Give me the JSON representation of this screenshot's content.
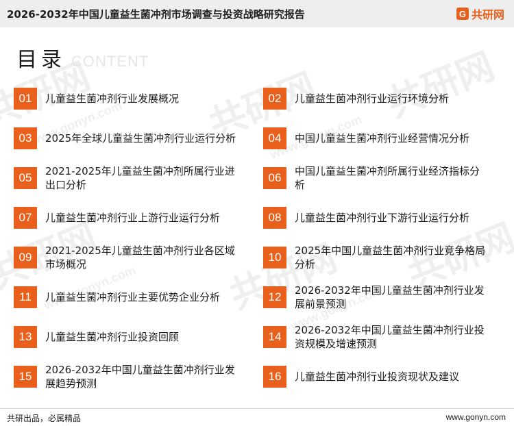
{
  "header": {
    "report_title": "2026-2032年中国儿童益生菌冲剂市场调查与投资战略研究报告",
    "brand_mark": "G",
    "brand_name": "共研网"
  },
  "toc": {
    "title": "目录",
    "subtitle": "CONTENT",
    "items": [
      {
        "num": "01",
        "label": "儿童益生菌冲剂行业发展概况"
      },
      {
        "num": "02",
        "label": "儿童益生菌冲剂行业运行环境分析"
      },
      {
        "num": "03",
        "label": "2025年全球儿童益生菌冲剂行业运行分析"
      },
      {
        "num": "04",
        "label": "中国儿童益生菌冲剂行业经营情况分析"
      },
      {
        "num": "05",
        "label": "2021-2025年儿童益生菌冲剂所属行业进出口分析"
      },
      {
        "num": "06",
        "label": "中国儿童益生菌冲剂所属行业经济指标分析"
      },
      {
        "num": "07",
        "label": "儿童益生菌冲剂行业上游行业运行分析"
      },
      {
        "num": "08",
        "label": "儿童益生菌冲剂行业下游行业运行分析"
      },
      {
        "num": "09",
        "label": "2021-2025年儿童益生菌冲剂行业各区域市场概况"
      },
      {
        "num": "10",
        "label": "2025年中国儿童益生菌冲剂行业竞争格局分析"
      },
      {
        "num": "11",
        "label": "儿童益生菌冲剂行业主要优势企业分析"
      },
      {
        "num": "12",
        "label": "2026-2032年中国儿童益生菌冲剂行业发展前景预测"
      },
      {
        "num": "13",
        "label": "儿童益生菌冲剂行业投资回顾"
      },
      {
        "num": "14",
        "label": "2026-2032年中国儿童益生菌冲剂行业投资规模及增速预测"
      },
      {
        "num": "15",
        "label": "2026-2032年中国儿童益生菌冲剂行业发展趋势预测"
      },
      {
        "num": "16",
        "label": "儿童益生菌冲剂行业投资现状及建议"
      }
    ]
  },
  "watermark": {
    "brand": "共研网",
    "domain": "www.gonyn.com"
  },
  "footer": {
    "slogan": "共研出品，必属精品",
    "url": "www.gonyn.com"
  },
  "colors": {
    "accent": "#e8601c",
    "topbar": "#eeeeee",
    "text": "#1a1a1a"
  }
}
